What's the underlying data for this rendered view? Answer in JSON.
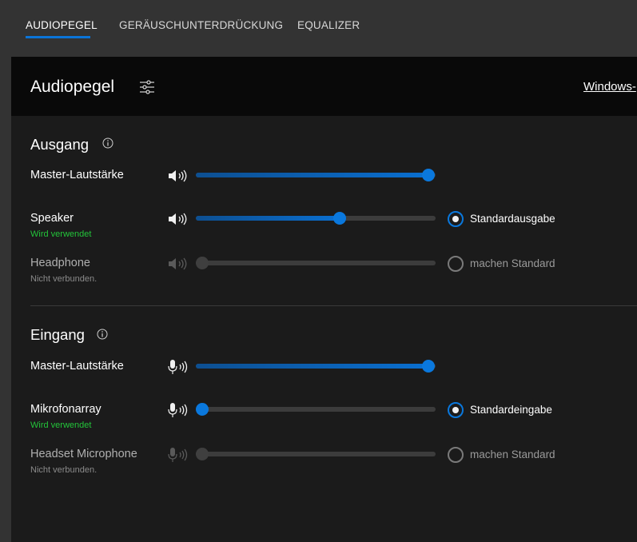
{
  "tabs": [
    {
      "label": "AUDIOPEGEL",
      "active": true
    },
    {
      "label": "GERÄUSCHUNTERDRÜCKUNG",
      "active": false
    },
    {
      "label": "EQUALIZER",
      "active": false
    }
  ],
  "header": {
    "title": "Audiopegel",
    "settings_icon": "sliders-icon",
    "link_text": "Windows-"
  },
  "output": {
    "title": "Ausgang",
    "master": {
      "label": "Master-Lautstärke",
      "level": 0.97,
      "icon": "speaker-icon"
    },
    "devices": [
      {
        "name": "Speaker",
        "status": "Wird verwendet",
        "level": 0.6,
        "connected": true,
        "radio_label": "Standardausgabe",
        "is_default": true
      },
      {
        "name": "Headphone",
        "status": "Nicht verbunden.",
        "level": 0.0,
        "connected": false,
        "radio_label": "machen Standard",
        "is_default": false
      }
    ]
  },
  "input": {
    "title": "Eingang",
    "master": {
      "label": "Master-Lautstärke",
      "level": 0.97,
      "icon": "microphone-icon"
    },
    "devices": [
      {
        "name": "Mikrofonarray",
        "status": "Wird verwendet",
        "level": 0.0,
        "connected": true,
        "radio_label": "Standardeingabe",
        "is_default": true
      },
      {
        "name": "Headset Microphone",
        "status": "Nicht verbunden.",
        "level": 0.0,
        "connected": false,
        "radio_label": "machen Standard",
        "is_default": false
      }
    ]
  },
  "colors": {
    "accent": "#0a78dd",
    "status_active": "#23c43a",
    "status_inactive": "#8a8a8a"
  }
}
